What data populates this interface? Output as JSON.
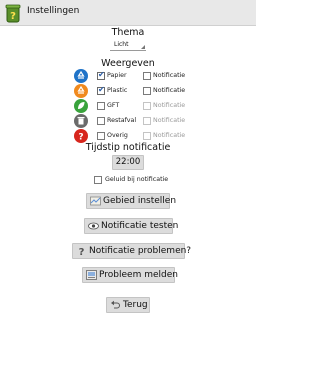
{
  "actionbar": {
    "title": "Instellingen"
  },
  "thema": {
    "title": "Thema",
    "selected": "Licht"
  },
  "weergeven": {
    "title": "Weergeven",
    "rows": [
      {
        "label": "Papier",
        "checked": true,
        "notif_label": "Notificatie",
        "notif_enabled": true,
        "color": "#1f73c8",
        "icon": "recycle-icon"
      },
      {
        "label": "Plastic",
        "checked": true,
        "notif_label": "Notificatie",
        "notif_enabled": true,
        "color": "#f08a1e",
        "icon": "recycle-icon"
      },
      {
        "label": "GFT",
        "checked": false,
        "notif_label": "Notificatie",
        "notif_enabled": false,
        "color": "#39a33c",
        "icon": "leaf-icon"
      },
      {
        "label": "Restafval",
        "checked": false,
        "notif_label": "Notificatie",
        "notif_enabled": false,
        "color": "#6b6b6b",
        "icon": "trash-icon"
      },
      {
        "label": "Overig",
        "checked": false,
        "notif_label": "Notificatie",
        "notif_enabled": false,
        "color": "#d7261d",
        "icon": "question-icon"
      }
    ]
  },
  "notificatie": {
    "title": "Tijdstip notificatie",
    "time": "22:00",
    "sound_label": "Geluid bij notificatie"
  },
  "buttons": {
    "area": "Gebied instellen",
    "test": "Notificatie testen",
    "problems": "Notificatie problemen?",
    "report": "Probleem melden",
    "back": "Terug"
  }
}
